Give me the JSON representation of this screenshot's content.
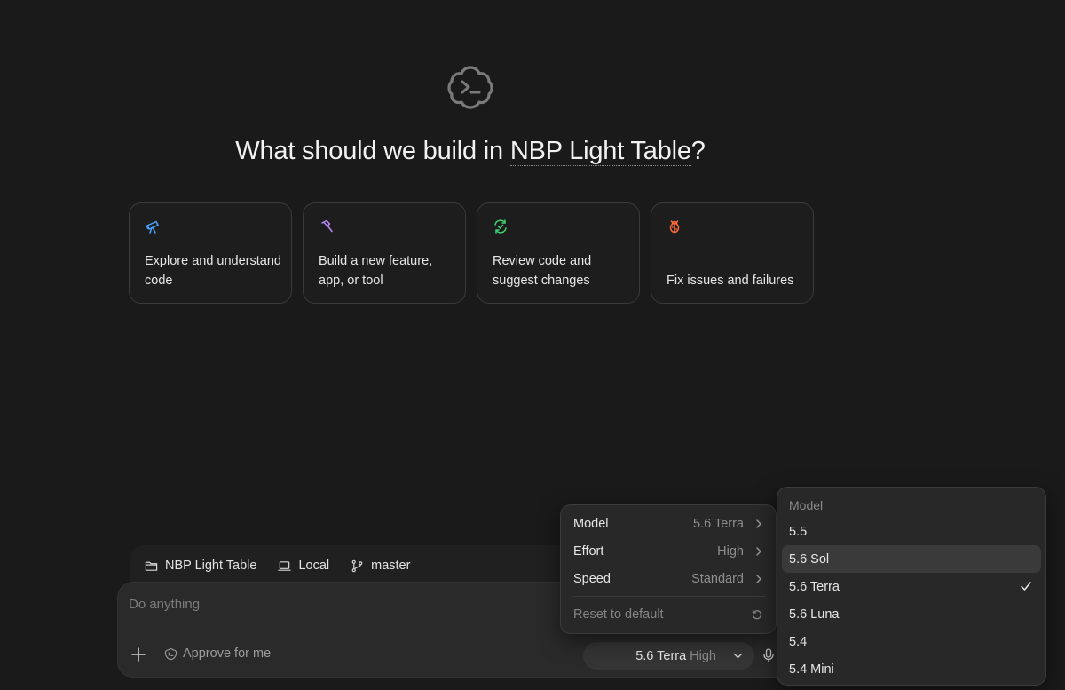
{
  "headline": {
    "prefix": "What should we build in ",
    "project": "NBP Light Table",
    "suffix": "?"
  },
  "cards": [
    {
      "icon": "telescope-icon",
      "color": "#4aa3ff",
      "label": "Explore and understand code"
    },
    {
      "icon": "hammer-icon",
      "color": "#b98cf5",
      "label": "Build a new feature, app, or tool"
    },
    {
      "icon": "review-cycle-icon",
      "color": "#3fcf6e",
      "label": "Review code and suggest changes"
    },
    {
      "icon": "bug-icon",
      "color": "#ff6a3a",
      "label": "Fix issues and failures"
    }
  ],
  "context": {
    "project": "NBP Light Table",
    "environment": "Local",
    "branch": "master"
  },
  "composer": {
    "placeholder": "Do anything",
    "approve_label": "Approve for me",
    "model_name": "5.6 Terra",
    "model_effort": "High"
  },
  "menu": {
    "rows": [
      {
        "label": "Model",
        "value": "5.6 Terra"
      },
      {
        "label": "Effort",
        "value": "High"
      },
      {
        "label": "Speed",
        "value": "Standard"
      }
    ],
    "reset_label": "Reset to default"
  },
  "submenu": {
    "header": "Model",
    "options": [
      "5.5",
      "5.6 Sol",
      "5.6 Terra",
      "5.6 Luna",
      "5.4",
      "5.4 Mini"
    ],
    "hovered": "5.6 Sol",
    "selected": "5.6 Terra"
  }
}
